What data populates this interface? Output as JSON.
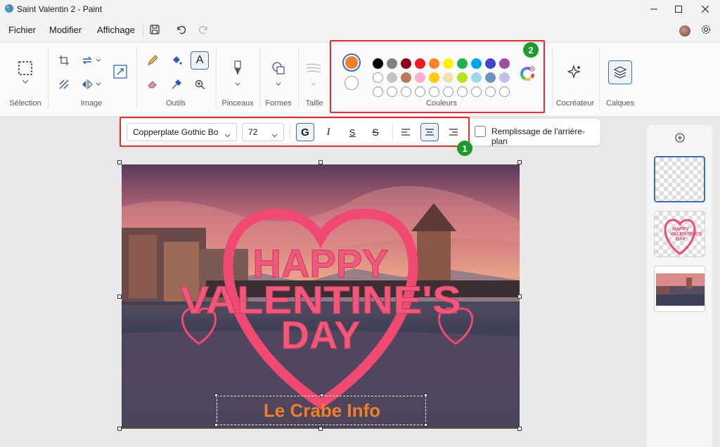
{
  "window": {
    "title": "Saint Valentin 2 - Paint"
  },
  "menu": {
    "items": [
      "Fichier",
      "Modifier",
      "Affichage"
    ]
  },
  "ribbon": {
    "groups": {
      "selection": "Sélection",
      "image": "Image",
      "tools": "Outils",
      "brushes": "Pinceaux",
      "shapes": "Formes",
      "size": "Taille",
      "colors": "Couleurs",
      "cocreator": "Cocréateur",
      "layers": "Calques"
    },
    "colors": {
      "primary": "#f07f2a",
      "secondary": "#ffffff",
      "row1": [
        "#000000",
        "#7f7f7f",
        "#880015",
        "#ed1c24",
        "#ff7f27",
        "#fff200",
        "#22b14c",
        "#00a2e8",
        "#3f48cc",
        "#a349a4"
      ],
      "row2": [
        "#ffffff",
        "#c3c3c3",
        "#b97a57",
        "#ffaec9",
        "#ffc90e",
        "#efe4b0",
        "#b5e61d",
        "#99d9ea",
        "#7092be",
        "#c8bfe7"
      ]
    }
  },
  "text_toolbar": {
    "font": "Copperplate Gothic Bo",
    "size": "72",
    "bold": "G",
    "italic": "I",
    "underline": "S",
    "strike": "S",
    "background_fill_label": "Remplissage de l'arrière-plan"
  },
  "annotations": {
    "badge1": "1",
    "badge2": "2"
  },
  "canvas": {
    "line1": "HAPPY",
    "line2": "VALENTINE'S",
    "line3": "DAY",
    "text_box": "Le Crabe Info",
    "thumb_text": "HAPPY VALENTINE'S DAY"
  }
}
